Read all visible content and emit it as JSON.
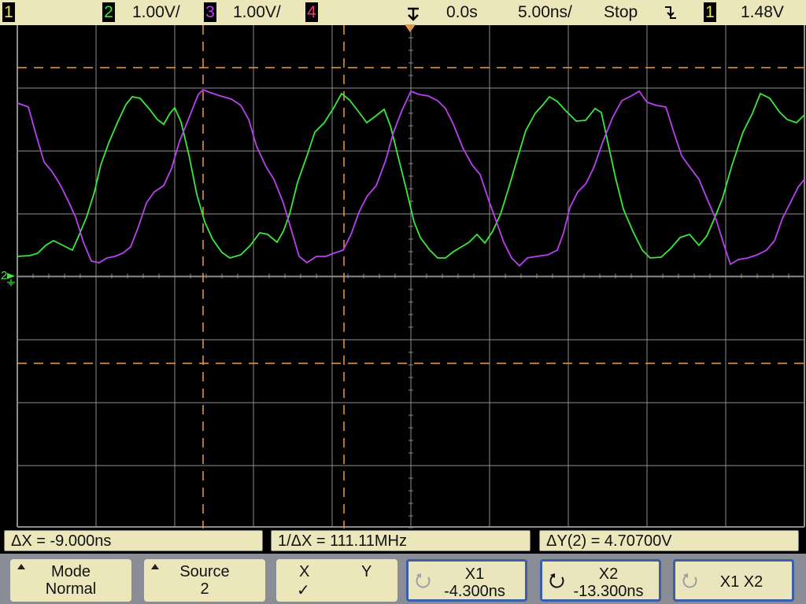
{
  "topbar": {
    "ch1_num": "1",
    "ch2_num": "2",
    "ch2_scale": "1.00V/",
    "ch3_num": "3",
    "ch3_scale": "1.00V/",
    "ch4_num": "4",
    "trigger_marker_icon": "trigger-position-icon",
    "delay": "0.0s",
    "timebase": "5.00ns/",
    "run_state": "Stop",
    "trigger_slope_icon": "falling-edge-icon",
    "trigger_source": "1",
    "trigger_level": "1.48V"
  },
  "colors": {
    "ch1": "#f0e04a",
    "ch2": "#39e93c",
    "ch3": "#bb41f0",
    "ch4": "#f03a70",
    "cursor": "#f39a3a",
    "grid": "#8c8c8c",
    "topbar_bg": "#ece7bb",
    "softkey_bar": "#8a8d96",
    "active_border": "#3b5fa6"
  },
  "ground_marker": "2",
  "measurements": {
    "delta_x": "ΔX = -9.000ns",
    "inv_delta_x": "1/ΔX = 111.11MHz",
    "delta_y": "ΔY(2) = 4.70700V"
  },
  "softkeys": [
    {
      "line1": "Mode",
      "line2": "Normal"
    },
    {
      "line1": "Source",
      "line2": "2"
    },
    {
      "line1_left": "X",
      "line1_right": "Y",
      "line2": "✓"
    },
    {
      "line1": "X1",
      "line2": "-4.300ns"
    },
    {
      "line1": "X2",
      "line2": "-13.300ns"
    },
    {
      "line1": "X1 X2"
    }
  ]
}
